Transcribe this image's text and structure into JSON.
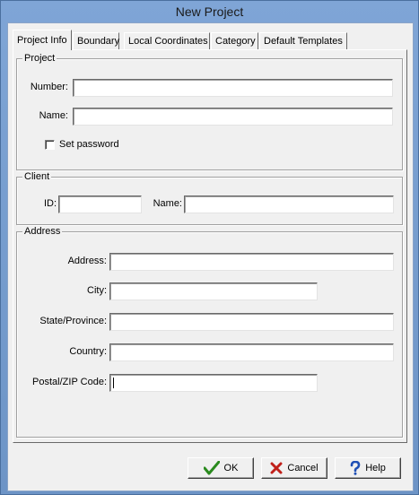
{
  "window": {
    "title": "New Project"
  },
  "tabs": [
    {
      "label": "Project Info",
      "active": true
    },
    {
      "label": "Boundary"
    },
    {
      "label": "Local Coordinates"
    },
    {
      "label": "Category"
    },
    {
      "label": "Default Templates"
    }
  ],
  "project_group": {
    "legend": "Project",
    "number_label": "Number:",
    "number_value": "",
    "name_label": "Name:",
    "name_value": "",
    "set_password_label": "Set password",
    "set_password_checked": false
  },
  "client_group": {
    "legend": "Client",
    "id_label": "ID:",
    "id_value": "",
    "name_label": "Name:",
    "name_value": ""
  },
  "address_group": {
    "legend": "Address",
    "address_label": "Address:",
    "address_value": "",
    "city_label": "City:",
    "city_value": "",
    "state_label": "State/Province:",
    "state_value": "",
    "country_label": "Country:",
    "country_value": "",
    "postal_label": "Postal/ZIP Code:",
    "postal_value": ""
  },
  "buttons": {
    "ok": {
      "label": "OK",
      "icon": "checkmark-icon",
      "color": "#2a8a1e"
    },
    "cancel": {
      "label": "Cancel",
      "icon": "x-icon",
      "color": "#c0201a"
    },
    "help": {
      "label": "Help",
      "icon": "question-icon",
      "color": "#1f4fb5"
    }
  }
}
